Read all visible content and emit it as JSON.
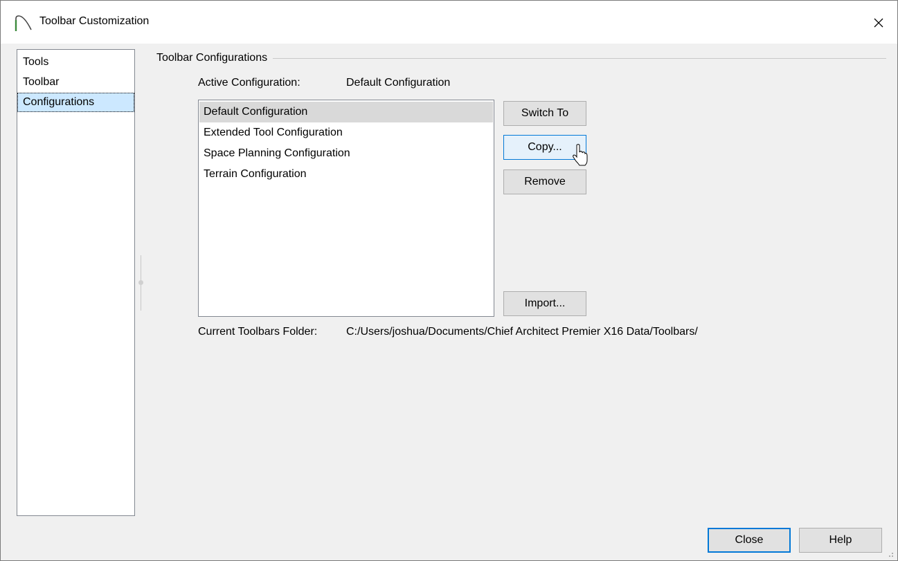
{
  "window": {
    "title": "Toolbar Customization"
  },
  "nav": {
    "items": [
      {
        "label": "Tools",
        "selected": false
      },
      {
        "label": "Toolbar",
        "selected": false
      },
      {
        "label": "Configurations",
        "selected": true
      }
    ]
  },
  "group": {
    "title": "Toolbar Configurations",
    "active_label": "Active Configuration:",
    "active_value": "Default Configuration",
    "configurations": [
      {
        "label": "Default Configuration",
        "selected": true
      },
      {
        "label": "Extended Tool Configuration",
        "selected": false
      },
      {
        "label": "Space Planning Configuration",
        "selected": false
      },
      {
        "label": "Terrain Configuration",
        "selected": false
      }
    ],
    "buttons": {
      "switch_to": "Switch To",
      "copy": "Copy...",
      "remove": "Remove",
      "import": "Import..."
    },
    "folder_label": "Current Toolbars Folder:",
    "folder_value": "C:/Users/joshua/Documents/Chief Architect Premier X16 Data/Toolbars/"
  },
  "footer": {
    "close": "Close",
    "help": "Help"
  },
  "colors": {
    "accent": "#0078d7",
    "selection": "#cce8ff",
    "list_selection": "#d9d9d9",
    "app_icon": "#3c8a3c"
  }
}
